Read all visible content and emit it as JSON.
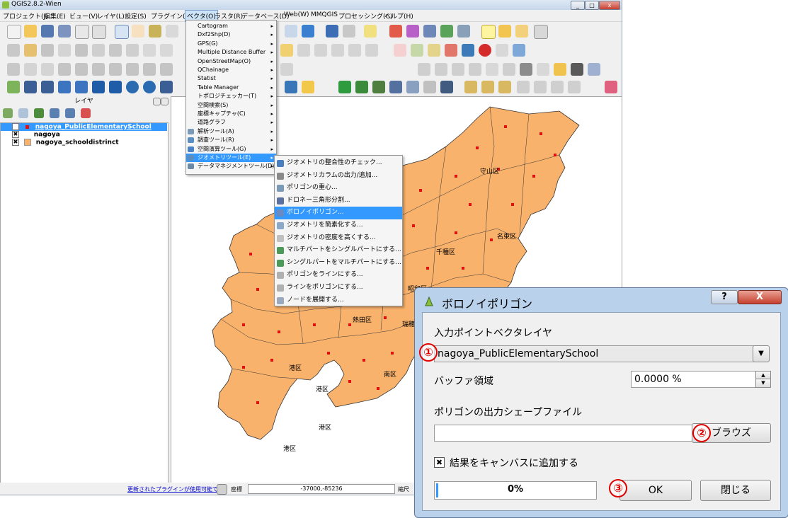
{
  "window": {
    "title": "QGIS2.8.2-Wien"
  },
  "menubar": [
    "プロジェクト(J)",
    "編集(E)",
    "ビュー(V)",
    "レイヤ(L)",
    "設定(S)",
    "プラグイン(P)",
    "ベクタ(O)",
    "ラスタ(R)",
    "データベース(D)",
    "Web(W)",
    "MMQGIS",
    "プロセッシング(C)",
    "ヘルプ(H)"
  ],
  "layers_panel": {
    "title": "レイヤ",
    "layers": [
      "nagoya_PublicElementarySchool",
      "nagoya",
      "nagoya_schooldistrinct"
    ]
  },
  "vector_menu": {
    "items": [
      "Cartogram",
      "Dxf2Shp(D)",
      "GPS(G)",
      "Multiple Distance Buffer",
      "OpenStreetMap(O)",
      "QChainage",
      "Statist",
      "Table Manager",
      "トポロジチェッカー(T)",
      "空間検索(S)",
      "座標キャプチャ(C)",
      "道路グラフ",
      "解析ツール(A)",
      "調査ツール(R)",
      "空間演算ツール(G)",
      "ジオメトリツール(E)",
      "データマネジメントツール(D)"
    ],
    "selected_index": 15
  },
  "geometry_menu": {
    "items": [
      "ジオメトリの整合性のチェック...",
      "ジオメトリカラムの出力/追加...",
      "ポリゴンの重心...",
      "ドロネー三角形分割...",
      "ボロノイポリゴン...",
      "ジオメトリを簡素化する...",
      "ジオメトリの密度を高くする...",
      "マルチパートをシングルパートにする...",
      "シングルパートをマルチパートにする...",
      "ポリゴンをラインにする...",
      "ラインをポリゴンにする...",
      "ノードを展開する..."
    ],
    "selected_index": 4
  },
  "map_labels": [
    "守山区",
    "名東区",
    "千種区",
    "昭和区",
    "熱田区",
    "瑞穂区",
    "南区",
    "港区",
    "港区",
    "港区",
    "港区"
  ],
  "status": {
    "plugin_link": "更新されたプラグインが使用可能です",
    "coord_label": "座標",
    "coord_value": "-37000,-85236",
    "scale_label": "縮尺"
  },
  "dialog": {
    "title": "ボロノイポリゴン",
    "help_btn": "?",
    "close_x": "X",
    "input_label": "入力ポイントベクタレイヤ",
    "input_value": "nagoya_PublicElementarySchool",
    "buffer_label": "バッファ領域",
    "buffer_value": "0.0000 %",
    "output_label": "ポリゴンの出力シェープファイル",
    "output_value": "",
    "browse": "ブラウズ",
    "add_checkbox": "結果をキャンバスに追加する",
    "progress": "0%",
    "ok": "OK",
    "close": "閉じる",
    "marker1": "①",
    "marker2": "②",
    "marker3": "③"
  },
  "colors": {
    "polygon_fill": "#f9b26c",
    "point": "#e01010",
    "highlight": "#3399ff"
  }
}
